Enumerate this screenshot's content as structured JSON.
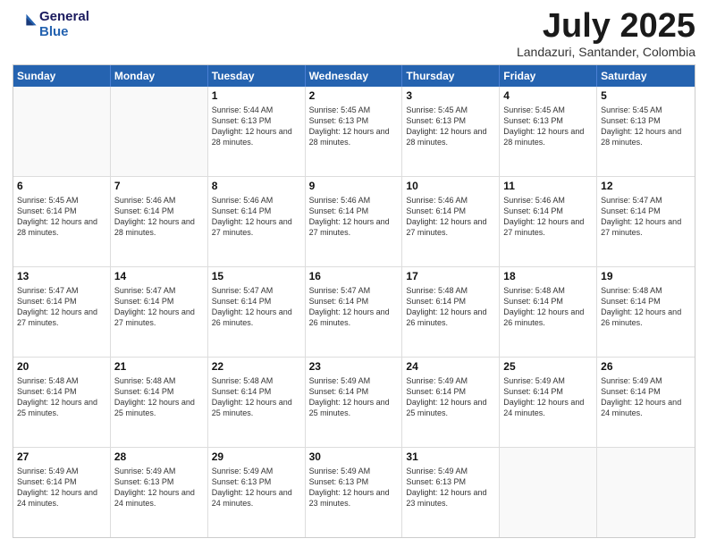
{
  "header": {
    "logo_line1": "General",
    "logo_line2": "Blue",
    "title": "July 2025",
    "subtitle": "Landazuri, Santander, Colombia"
  },
  "calendar": {
    "days_of_week": [
      "Sunday",
      "Monday",
      "Tuesday",
      "Wednesday",
      "Thursday",
      "Friday",
      "Saturday"
    ],
    "weeks": [
      [
        {
          "day": "",
          "info": ""
        },
        {
          "day": "",
          "info": ""
        },
        {
          "day": "1",
          "info": "Sunrise: 5:44 AM\nSunset: 6:13 PM\nDaylight: 12 hours and 28 minutes."
        },
        {
          "day": "2",
          "info": "Sunrise: 5:45 AM\nSunset: 6:13 PM\nDaylight: 12 hours and 28 minutes."
        },
        {
          "day": "3",
          "info": "Sunrise: 5:45 AM\nSunset: 6:13 PM\nDaylight: 12 hours and 28 minutes."
        },
        {
          "day": "4",
          "info": "Sunrise: 5:45 AM\nSunset: 6:13 PM\nDaylight: 12 hours and 28 minutes."
        },
        {
          "day": "5",
          "info": "Sunrise: 5:45 AM\nSunset: 6:13 PM\nDaylight: 12 hours and 28 minutes."
        }
      ],
      [
        {
          "day": "6",
          "info": "Sunrise: 5:45 AM\nSunset: 6:14 PM\nDaylight: 12 hours and 28 minutes."
        },
        {
          "day": "7",
          "info": "Sunrise: 5:46 AM\nSunset: 6:14 PM\nDaylight: 12 hours and 28 minutes."
        },
        {
          "day": "8",
          "info": "Sunrise: 5:46 AM\nSunset: 6:14 PM\nDaylight: 12 hours and 27 minutes."
        },
        {
          "day": "9",
          "info": "Sunrise: 5:46 AM\nSunset: 6:14 PM\nDaylight: 12 hours and 27 minutes."
        },
        {
          "day": "10",
          "info": "Sunrise: 5:46 AM\nSunset: 6:14 PM\nDaylight: 12 hours and 27 minutes."
        },
        {
          "day": "11",
          "info": "Sunrise: 5:46 AM\nSunset: 6:14 PM\nDaylight: 12 hours and 27 minutes."
        },
        {
          "day": "12",
          "info": "Sunrise: 5:47 AM\nSunset: 6:14 PM\nDaylight: 12 hours and 27 minutes."
        }
      ],
      [
        {
          "day": "13",
          "info": "Sunrise: 5:47 AM\nSunset: 6:14 PM\nDaylight: 12 hours and 27 minutes."
        },
        {
          "day": "14",
          "info": "Sunrise: 5:47 AM\nSunset: 6:14 PM\nDaylight: 12 hours and 27 minutes."
        },
        {
          "day": "15",
          "info": "Sunrise: 5:47 AM\nSunset: 6:14 PM\nDaylight: 12 hours and 26 minutes."
        },
        {
          "day": "16",
          "info": "Sunrise: 5:47 AM\nSunset: 6:14 PM\nDaylight: 12 hours and 26 minutes."
        },
        {
          "day": "17",
          "info": "Sunrise: 5:48 AM\nSunset: 6:14 PM\nDaylight: 12 hours and 26 minutes."
        },
        {
          "day": "18",
          "info": "Sunrise: 5:48 AM\nSunset: 6:14 PM\nDaylight: 12 hours and 26 minutes."
        },
        {
          "day": "19",
          "info": "Sunrise: 5:48 AM\nSunset: 6:14 PM\nDaylight: 12 hours and 26 minutes."
        }
      ],
      [
        {
          "day": "20",
          "info": "Sunrise: 5:48 AM\nSunset: 6:14 PM\nDaylight: 12 hours and 25 minutes."
        },
        {
          "day": "21",
          "info": "Sunrise: 5:48 AM\nSunset: 6:14 PM\nDaylight: 12 hours and 25 minutes."
        },
        {
          "day": "22",
          "info": "Sunrise: 5:48 AM\nSunset: 6:14 PM\nDaylight: 12 hours and 25 minutes."
        },
        {
          "day": "23",
          "info": "Sunrise: 5:49 AM\nSunset: 6:14 PM\nDaylight: 12 hours and 25 minutes."
        },
        {
          "day": "24",
          "info": "Sunrise: 5:49 AM\nSunset: 6:14 PM\nDaylight: 12 hours and 25 minutes."
        },
        {
          "day": "25",
          "info": "Sunrise: 5:49 AM\nSunset: 6:14 PM\nDaylight: 12 hours and 24 minutes."
        },
        {
          "day": "26",
          "info": "Sunrise: 5:49 AM\nSunset: 6:14 PM\nDaylight: 12 hours and 24 minutes."
        }
      ],
      [
        {
          "day": "27",
          "info": "Sunrise: 5:49 AM\nSunset: 6:14 PM\nDaylight: 12 hours and 24 minutes."
        },
        {
          "day": "28",
          "info": "Sunrise: 5:49 AM\nSunset: 6:13 PM\nDaylight: 12 hours and 24 minutes."
        },
        {
          "day": "29",
          "info": "Sunrise: 5:49 AM\nSunset: 6:13 PM\nDaylight: 12 hours and 24 minutes."
        },
        {
          "day": "30",
          "info": "Sunrise: 5:49 AM\nSunset: 6:13 PM\nDaylight: 12 hours and 23 minutes."
        },
        {
          "day": "31",
          "info": "Sunrise: 5:49 AM\nSunset: 6:13 PM\nDaylight: 12 hours and 23 minutes."
        },
        {
          "day": "",
          "info": ""
        },
        {
          "day": "",
          "info": ""
        }
      ]
    ]
  }
}
